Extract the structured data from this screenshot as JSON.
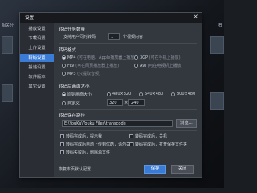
{
  "background": {
    "left_text": "相关分",
    "right_text": "荐"
  },
  "dialog": {
    "title": "设置",
    "close_icon": "×",
    "sidebar": {
      "items": [
        {
          "label": "播放设置",
          "active": false
        },
        {
          "label": "下载设置",
          "active": false
        },
        {
          "label": "上传设置",
          "active": false
        },
        {
          "label": "转码设置",
          "active": true
        },
        {
          "label": "投递设置",
          "active": false
        },
        {
          "label": "软件版本",
          "active": false
        },
        {
          "label": "其它设置",
          "active": false
        }
      ]
    },
    "tasks": {
      "heading": "转码任务数量",
      "prefix": "支持用户同时转码",
      "count": "1",
      "suffix": "个视频内容"
    },
    "format": {
      "heading": "转码格式",
      "options": [
        {
          "label": "MP4",
          "hint": "(可在电脑、Apple播放器上播放)",
          "selected": true
        },
        {
          "label": "3GP",
          "hint": "(可在手机上播放)",
          "selected": false
        },
        {
          "label": "FLV",
          "hint": "(可在网页播放器上播放)",
          "selected": false
        },
        {
          "label": "AVI",
          "hint": "(可在电视机上播放)",
          "selected": false
        },
        {
          "label": "MP3",
          "hint": "(只提取音频)",
          "selected": false
        }
      ]
    },
    "size": {
      "heading": "转码后画面大小",
      "options": [
        {
          "label": "原始画面大小",
          "selected": true
        },
        {
          "label": "480×320",
          "selected": false
        },
        {
          "label": "640×480",
          "selected": false
        },
        {
          "label": "800×480",
          "selected": false
        }
      ],
      "custom_label": "自定义",
      "custom_width": "320",
      "custom_sep": "×",
      "custom_height": "240"
    },
    "path": {
      "heading": "转码保存路径",
      "value": "E:\\YouKu\\Youku Files\\transcode",
      "browse_label": "浏览..."
    },
    "options": [
      {
        "label": "转码完成后，提示我",
        "checked": true
      },
      {
        "label": "转码完成后，关机",
        "checked": false
      },
      {
        "label": "转码完成后自动上传到优酷，请勿关闭",
        "checked": false
      },
      {
        "label": "转码完成后，打开保存文件夹",
        "checked": true
      },
      {
        "label": "转码失败后，删除源文件",
        "checked": false
      }
    ],
    "footer": {
      "restore_label": "恢复本页默认配置",
      "save_label": "保存",
      "close_label": "关闭"
    }
  }
}
